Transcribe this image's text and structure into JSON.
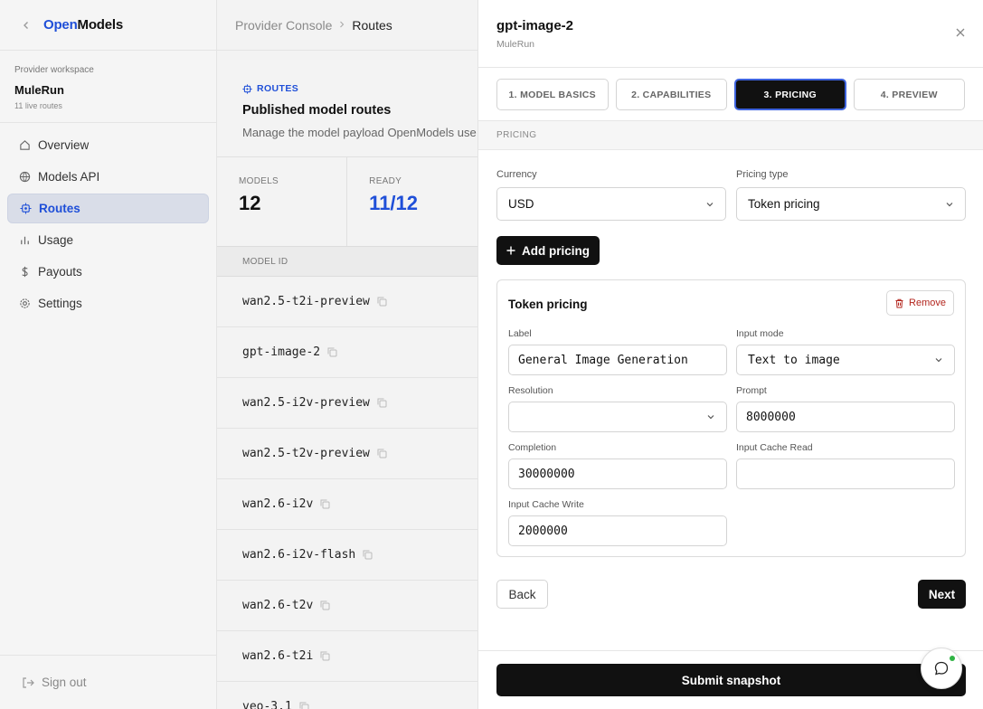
{
  "sidebar": {
    "logo_open": "Open",
    "logo_models": "Models",
    "workspace_label": "Provider workspace",
    "workspace_name": "MuleRun",
    "workspace_sub": "11 live routes",
    "nav": [
      {
        "label": "Overview",
        "icon": "home-icon"
      },
      {
        "label": "Models API",
        "icon": "globe-icon"
      },
      {
        "label": "Routes",
        "icon": "routes-icon",
        "active": true
      },
      {
        "label": "Usage",
        "icon": "bar-chart-icon"
      },
      {
        "label": "Payouts",
        "icon": "dollar-icon"
      },
      {
        "label": "Settings",
        "icon": "gear-icon"
      }
    ],
    "sign_out": "Sign out"
  },
  "main": {
    "breadcrumb": [
      "Provider Console",
      "Routes"
    ],
    "kicker": "ROUTES",
    "title": "Published model routes",
    "subtitle": "Manage the model payload OpenModels use",
    "stats": [
      {
        "label": "MODELS",
        "value": "12"
      },
      {
        "label": "READY",
        "value": "11/12"
      }
    ],
    "table_header": "MODEL ID",
    "rows": [
      "wan2.5-t2i-preview",
      "gpt-image-2",
      "wan2.5-i2v-preview",
      "wan2.5-t2v-preview",
      "wan2.6-i2v",
      "wan2.6-i2v-flash",
      "wan2.6-t2v",
      "wan2.6-t2i",
      "veo-3.1"
    ]
  },
  "drawer": {
    "title": "gpt-image-2",
    "subtitle": "MuleRun",
    "steps": [
      "1. MODEL BASICS",
      "2. CAPABILITIES",
      "3. PRICING",
      "4. PREVIEW"
    ],
    "active_step": 2,
    "section": "PRICING",
    "currency_label": "Currency",
    "currency_value": "USD",
    "pricing_type_label": "Pricing type",
    "pricing_type_value": "Token pricing",
    "add_pricing": "Add pricing",
    "card": {
      "title": "Token pricing",
      "remove": "Remove",
      "label_label": "Label",
      "label_value": "General Image Generation",
      "input_mode_label": "Input mode",
      "input_mode_value": "Text to image",
      "resolution_label": "Resolution",
      "resolution_value": "",
      "prompt_label": "Prompt",
      "prompt_value": "8000000",
      "completion_label": "Completion",
      "completion_value": "30000000",
      "cache_read_label": "Input Cache Read",
      "cache_read_value": "",
      "cache_write_label": "Input Cache Write",
      "cache_write_value": "2000000"
    },
    "back": "Back",
    "next": "Next",
    "submit": "Submit snapshot"
  },
  "colors": {
    "accent": "#1f4fd8",
    "danger": "#b3261e",
    "online": "#2fb344"
  }
}
